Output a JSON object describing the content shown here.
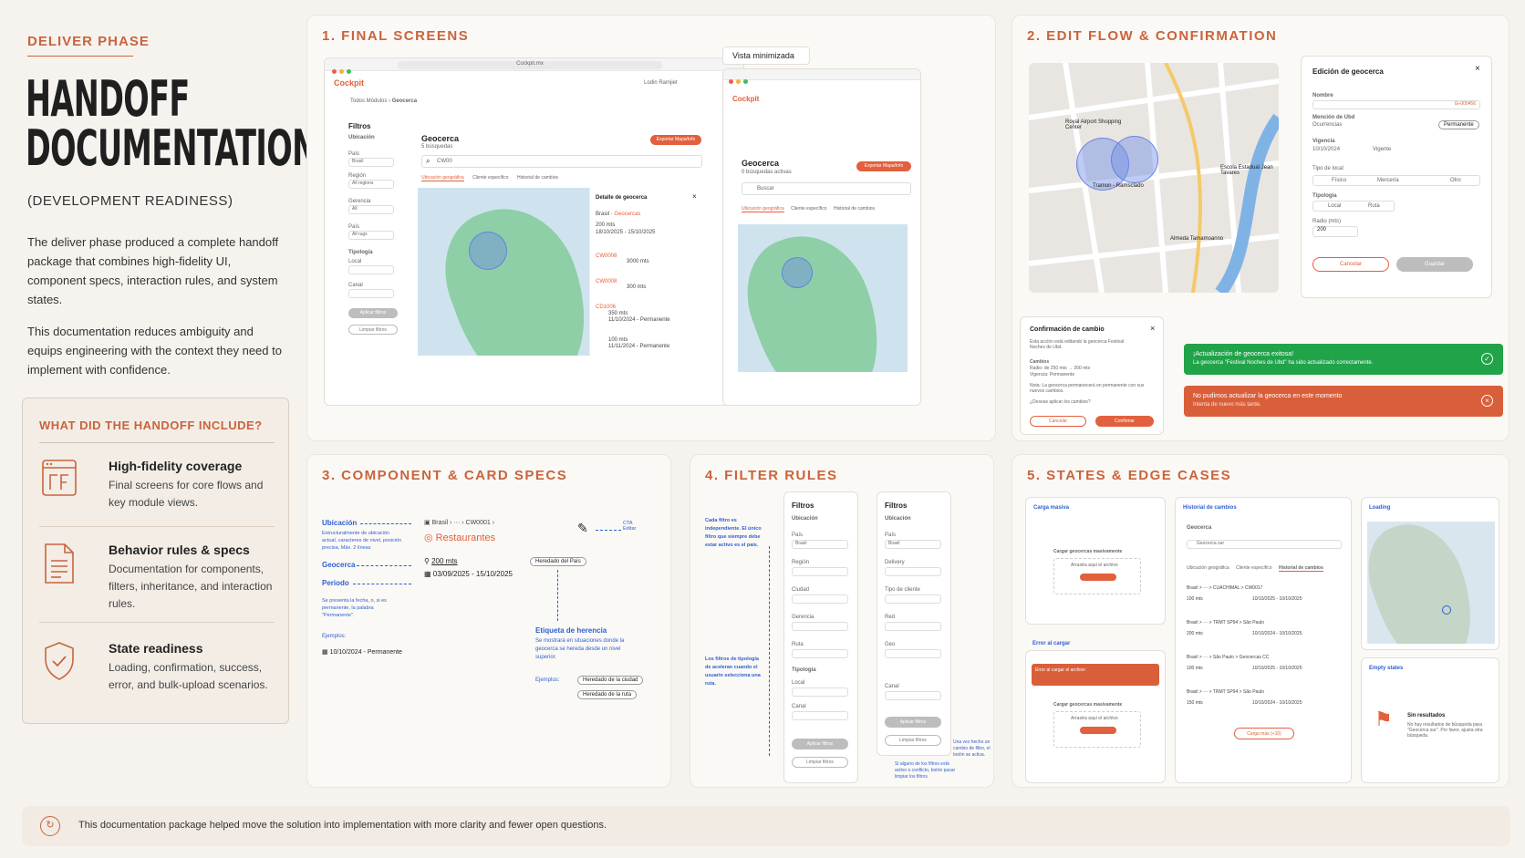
{
  "sidebar": {
    "phase": "DELIVER PHASE",
    "title_line1": "HANDOFF",
    "title_line2": "DOCUMENTATION",
    "subtitle": "(DEVELOPMENT READINESS)",
    "para1": "The deliver phase produced a complete handoff package that combines high-fidelity UI, component specs, interaction rules, and system states.",
    "para2": "This documentation reduces ambiguity and equips engineering with the context they need to implement with confidence.",
    "box_title": "WHAT DID THE HANDOFF INCLUDE?",
    "items": [
      {
        "title": "High-fidelity coverage",
        "desc": "Final screens for core flows and key module views."
      },
      {
        "title": "Behavior rules & specs",
        "desc": "Documentation for components, filters, inheritance, and interaction rules."
      },
      {
        "title": "State readiness",
        "desc": "Loading, confirmation, success, error, and bulk-upload scenarios."
      }
    ]
  },
  "footer": "This documentation package helped move the solution into implementation with more clarity and fewer open questions.",
  "sections": {
    "s1": "1. FINAL SCREENS",
    "s2": "2. EDIT FLOW & CONFIRMATION",
    "s3": "3. COMPONENT & CARD SPECS",
    "s4": "4. FILTER RULES",
    "s5": "5. STATES & EDGE CASES"
  },
  "screen1": {
    "url": "Cockpit.mx",
    "logo": "Cockpit",
    "user": "Lodin Ramjiet",
    "breadcrumb1": "Todos Módulos",
    "breadcrumb2": "Geocerca",
    "filters_title": "Filtros",
    "ubicacion": "Ubicación",
    "pais": "País",
    "pais_val": "Brasil",
    "region": "Región",
    "region_val": "All regions",
    "gerencia": "Gerencia",
    "gerencia_val": "All",
    "pais2": "País",
    "pais2_val": "All rugs",
    "tipologia": "Tipología",
    "local": "Local",
    "canal": "Canal",
    "apply": "Aplicar filtros",
    "clear": "Limpiar filtros",
    "main_title": "Geocerca",
    "main_sub": "5 búsquedas",
    "export": "Exportar Mapa/Info",
    "search_val": "CW00",
    "tabs": [
      "Ubicación geográfica",
      "Cliente específico",
      "Historial de cambios"
    ],
    "detail_title": "Detalle de geocerca",
    "detail_rows": [
      {
        "code": "Brasil",
        "label": "Geocercas",
        "dist": "200 mts",
        "date": "18/10/2025 - 15/10/2025"
      },
      {
        "code": "CW0008",
        "label": "",
        "dist": "3000 mts",
        "date": ""
      },
      {
        "code": "CW0008",
        "label": "",
        "dist": "300 mts",
        "date": ""
      },
      {
        "code": "CD1006",
        "label": "",
        "dist": "350 mts",
        "date": "11/10/2024 - Permanente"
      },
      {
        "code": "",
        "label": "",
        "dist": "100 mts",
        "date": "11/11/2024 - Permanente"
      }
    ]
  },
  "screen2": {
    "label": "Vista minimizada",
    "logo": "Cockpit",
    "title": "Geocerca",
    "sub": "0 búsquedas activas",
    "export": "Exportar Mapa/Info",
    "search": "Buscar",
    "tabs": [
      "Ubicación geográfica",
      "Cliente específico",
      "Historial de cambios"
    ]
  },
  "edit": {
    "map_labels": [
      "Royal Airport Shopping Center",
      "Escola Estadual Jean Tavares",
      "Tramon - Ramsclado",
      "Almeda Tamamoanno"
    ],
    "modal_title": "Edición de geocerca",
    "nombre": "Nombre",
    "codigo": "Gi-000456",
    "mencion": "Mención de Ubd",
    "ocurrencias": "Ocurrencias",
    "permanente": "Permanente",
    "vigencia": "Vigencia",
    "vigencia_val": "10/10/2024",
    "vigente": "Vigente",
    "tipo_local": "Tipo de local",
    "tipo_opts": [
      "Físico",
      "Mercería",
      "Otro"
    ],
    "tipologia": "Tipología",
    "tipologia_opts": [
      "Local",
      "Ruta"
    ],
    "radio": "Radio (mts)",
    "radio_val": "200",
    "cancel": "Cancelar",
    "save": "Guardar",
    "confirm_title": "Confirmación de cambio",
    "confirm_text": "Esta acción está editando la geocerca Festival Noches de Ubd.",
    "cambios": "Cambios",
    "cambio1": "Radio: de 250 mts → 200 mts",
    "cambio2": "Vigencia: Permanente",
    "nota": "Nota: La geocerca permanecerá en permanente con sus nuevos cambios.",
    "pregunta": "¿Deseas aplicar los cambios?",
    "c_cancel": "Cancelar",
    "c_confirm": "Confirmar",
    "success_title": "¡Actualización de geocerca exitosa!",
    "success_text": "La geocerca \"Festival Noches de Ubd\" ha sido actualizado correctamente.",
    "error_title": "No pudimos actualizar la geocerca en este momento",
    "error_text": "Intenta de nuevo más tarde."
  },
  "spec": {
    "ubicacion": "Ubicación",
    "ubicacion_desc": "Estructuralmente de ubicación actual, caracteres de nivel, posición precisa, Máx. 2 líneas",
    "geocerca": "Geocerca",
    "periodo": "Periodo",
    "periodo_desc": "Se presenta la fecha, o, si es permanente, la palabra \"Permanente\".",
    "ejemplos": "Ejemplos:",
    "ejemplo_val": "10/10/2024 - Permanente",
    "card_country": "Brasil",
    "card_code": "CW0001",
    "card_name": "Restaurantes",
    "card_dist": "200 mts",
    "card_date": "03/09/2025 - 15/10/2025",
    "inherit_chip": "Heredado del País",
    "cta": "CTA Editar",
    "herencia_title": "Etiqueta de herencia",
    "herencia_desc": "Se mostrará en situaciones donde la geocerca se hereda desde un nivel superior.",
    "ejemplos2": "Ejemplos:",
    "chip1": "Heredado de la ciudad",
    "chip2": "Heredado de la ruta"
  },
  "filters": {
    "note1": "Cada filtro es independiente. El único filtro que siempre debe estar activo es el país.",
    "note2": "Los filtros de tipología de aceleran cuando el usuario selecciona una ruta.",
    "note3": "Una vez hecho un cambio de filtro, el botón se activa.",
    "note4": "Si alguno de los filtros está activo o conflicto, botón pasar limpiar los filtros.",
    "title": "Filtros",
    "ubicacion": "Ubicación",
    "labels_a": [
      "País",
      "Región",
      "Ciudad",
      "Gerencia",
      "Ruta"
    ],
    "labels_b": [
      "País",
      "Delivery",
      "Tipo de cliente",
      "Red",
      "Geo"
    ],
    "pais_val": "Brasil",
    "tipologia": "Tipología",
    "local": "Local",
    "canal": "Canal",
    "apply": "Aplicar filtros",
    "clear": "Limpiar filtros"
  },
  "states": {
    "bulk": "Carga masiva",
    "bulk_title": "Cargar geocercas masivamente",
    "bulk_drop": "Arrastra aquí el archivo",
    "history": "Historial de cambios",
    "history_geo": "Geocerca",
    "history_search": "Geocerca sur",
    "history_tabs": [
      "Ubicación geográfica",
      "Cliente específico",
      "Historial de cambios"
    ],
    "history_rows": [
      {
        "path": "Brasil > ··· > CUACHIMAL > CW0017",
        "dist": "100 mts",
        "date": "10/10/2025 - 10/10/2025"
      },
      {
        "path": "Brasil > ··· > TRMT SP94 > São Paulo",
        "dist": "200 mts",
        "date": "10/10/2024 - 10/10/2025"
      },
      {
        "path": "Brasil > ··· > São Paulo > Geocercas CC",
        "dist": "100 mts",
        "date": "10/10/2025 - 10/10/2025"
      },
      {
        "path": "Brasil > ··· > TRMT SP94 > São Paulo",
        "dist": "150 mts",
        "date": "10/10/2024 - 10/10/2025"
      }
    ],
    "more": "Carga más (+10)",
    "error_label": "Error al cargar",
    "error_banner": "Error al cargar el archivo",
    "loading": "Loading",
    "empty": "Empty states",
    "no_results": "Sin resultados",
    "no_results_desc": "No hay resultados de búsqueda para \"Geocerca sur\". Por favor, ajusta otra búsqueda."
  }
}
